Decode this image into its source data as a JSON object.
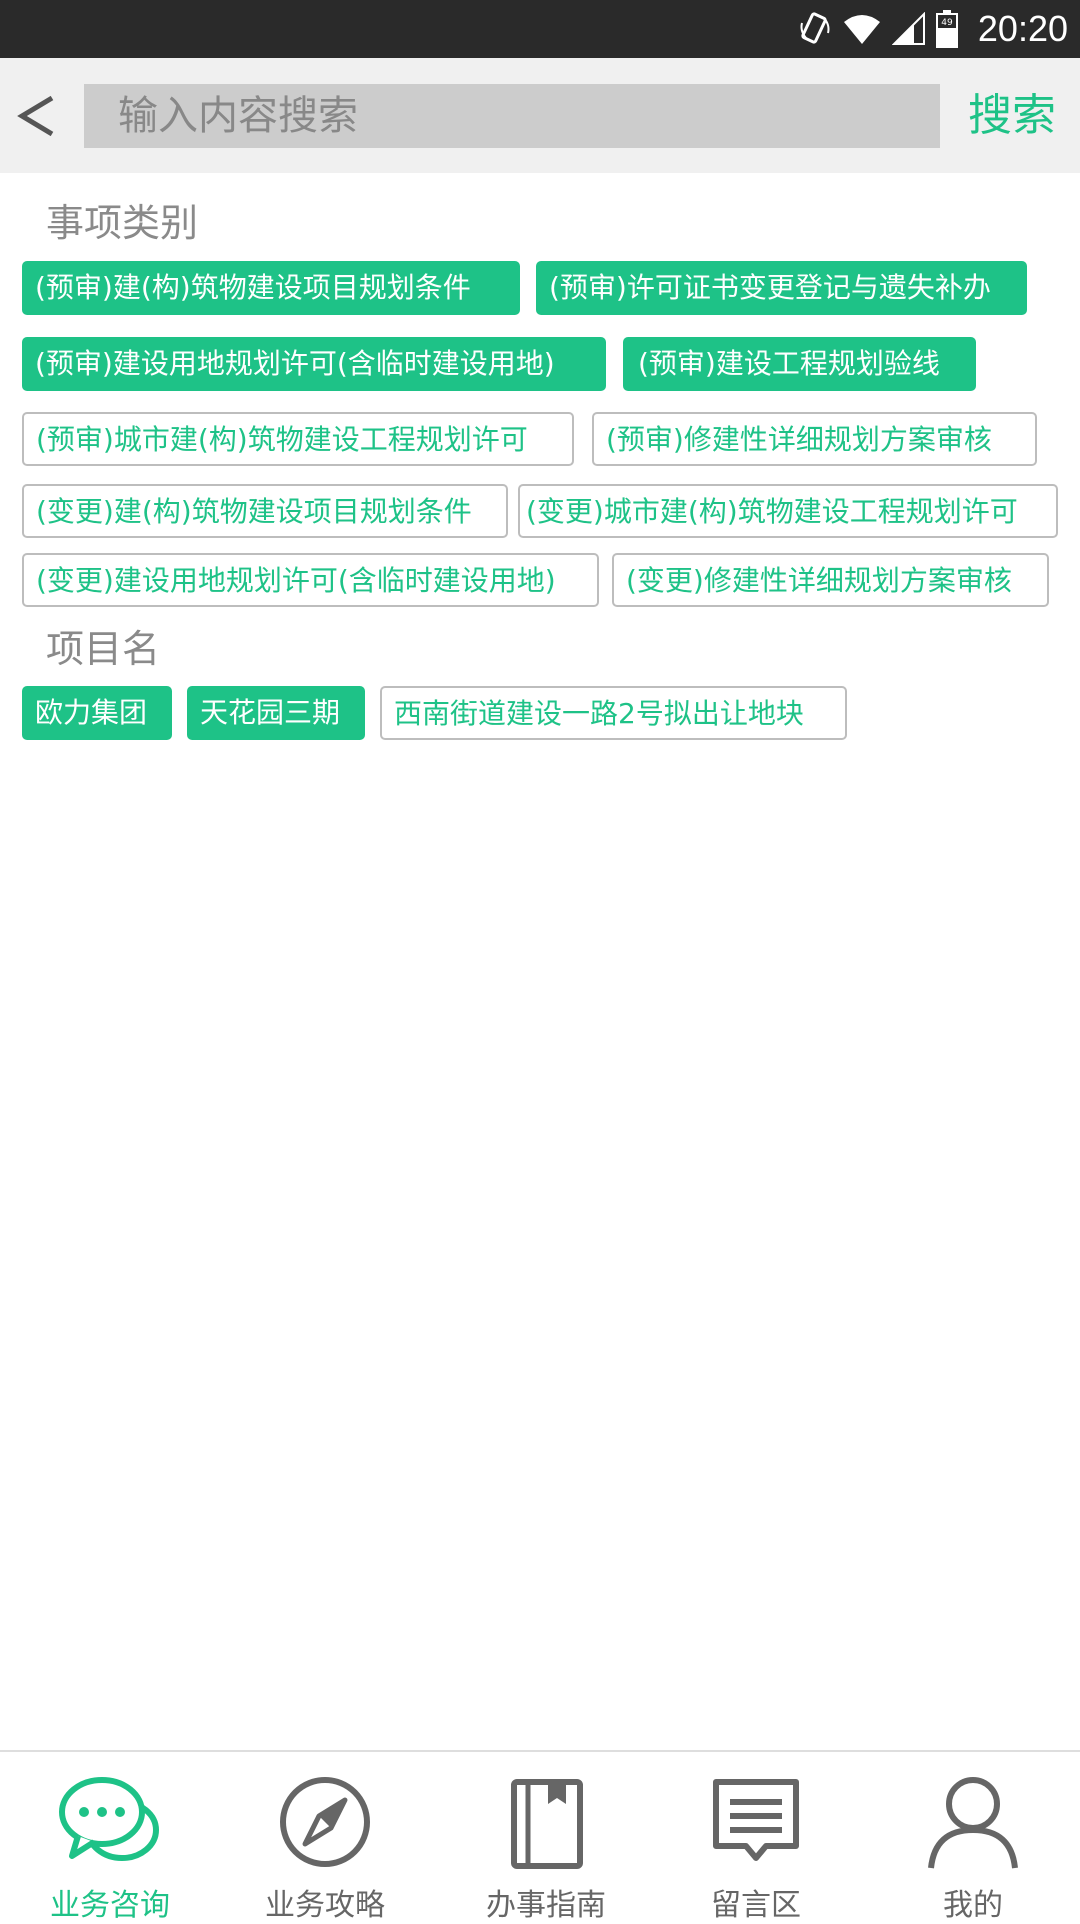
{
  "status_bar": {
    "time": "20:20",
    "battery_level": "49",
    "icons": [
      "rotate-icon",
      "wifi-icon",
      "signal-icon",
      "battery-icon"
    ]
  },
  "search": {
    "back_icon": "back-arrow-icon",
    "placeholder": "输入内容搜索",
    "value": "",
    "button_label": "搜索"
  },
  "categories": {
    "title": "事项类别",
    "tags": [
      {
        "label": "(预审)建(构)筑物建设项目规划条件",
        "selected": true
      },
      {
        "label": "(预审)许可证书变更登记与遗失补办",
        "selected": true
      },
      {
        "label": "(预审)建设用地规划许可(含临时建设用地)",
        "selected": true
      },
      {
        "label": "(预审)建设工程规划验线",
        "selected": true
      },
      {
        "label": "(预审)城市建(构)筑物建设工程规划许可",
        "selected": false
      },
      {
        "label": "(预审)修建性详细规划方案审核",
        "selected": false
      },
      {
        "label": "(变更)建(构)筑物建设项目规划条件",
        "selected": false
      },
      {
        "label": "(变更)城市建(构)筑物建设工程规划许可",
        "selected": false
      },
      {
        "label": "(变更)建设用地规划许可(含临时建设用地)",
        "selected": false
      },
      {
        "label": "(变更)修建性详细规划方案审核",
        "selected": false
      }
    ]
  },
  "projects": {
    "title": "项目名",
    "tags": [
      {
        "label": "欧力集团",
        "selected": true
      },
      {
        "label": "天花园三期",
        "selected": true
      },
      {
        "label": "西南街道建设一路2号拟出让地块",
        "selected": false
      }
    ]
  },
  "colors": {
    "accent": "#1ec287",
    "header_bg": "#f0f0f0",
    "search_bg": "#cccccc",
    "status_bar_bg": "#2a2a2a"
  },
  "bottom_nav": {
    "items": [
      {
        "label": "业务咨询",
        "icon": "chat-bubbles-icon",
        "active": true
      },
      {
        "label": "业务攻略",
        "icon": "compass-icon",
        "active": false
      },
      {
        "label": "办事指南",
        "icon": "book-icon",
        "active": false
      },
      {
        "label": "留言区",
        "icon": "message-icon",
        "active": false
      },
      {
        "label": "我的",
        "icon": "user-icon",
        "active": false
      }
    ]
  }
}
